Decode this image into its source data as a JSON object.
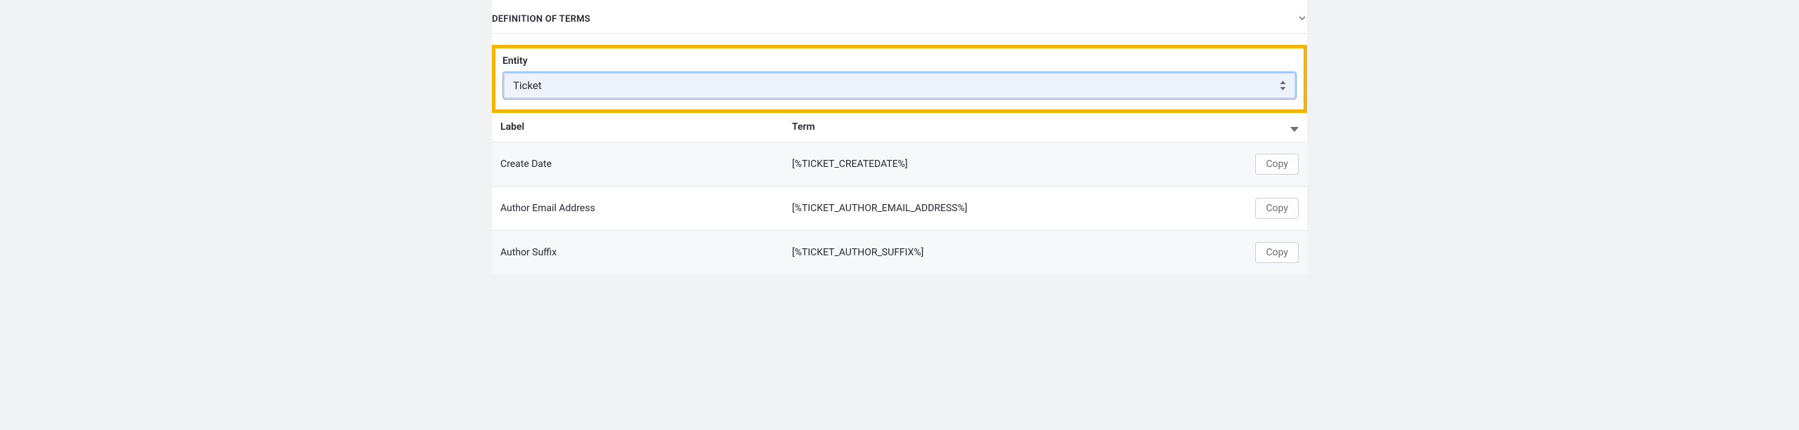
{
  "section": {
    "title": "DEFINITION OF TERMS"
  },
  "entity": {
    "label": "Entity",
    "selected": "Ticket"
  },
  "table": {
    "headers": {
      "label": "Label",
      "term": "Term"
    },
    "copy_label": "Copy",
    "rows": [
      {
        "label": "Create Date",
        "term": "[%TICKET_CREATEDATE%]"
      },
      {
        "label": "Author Email Address",
        "term": "[%TICKET_AUTHOR_EMAIL_ADDRESS%]"
      },
      {
        "label": "Author Suffix",
        "term": "[%TICKET_AUTHOR_SUFFIX%]"
      }
    ]
  }
}
